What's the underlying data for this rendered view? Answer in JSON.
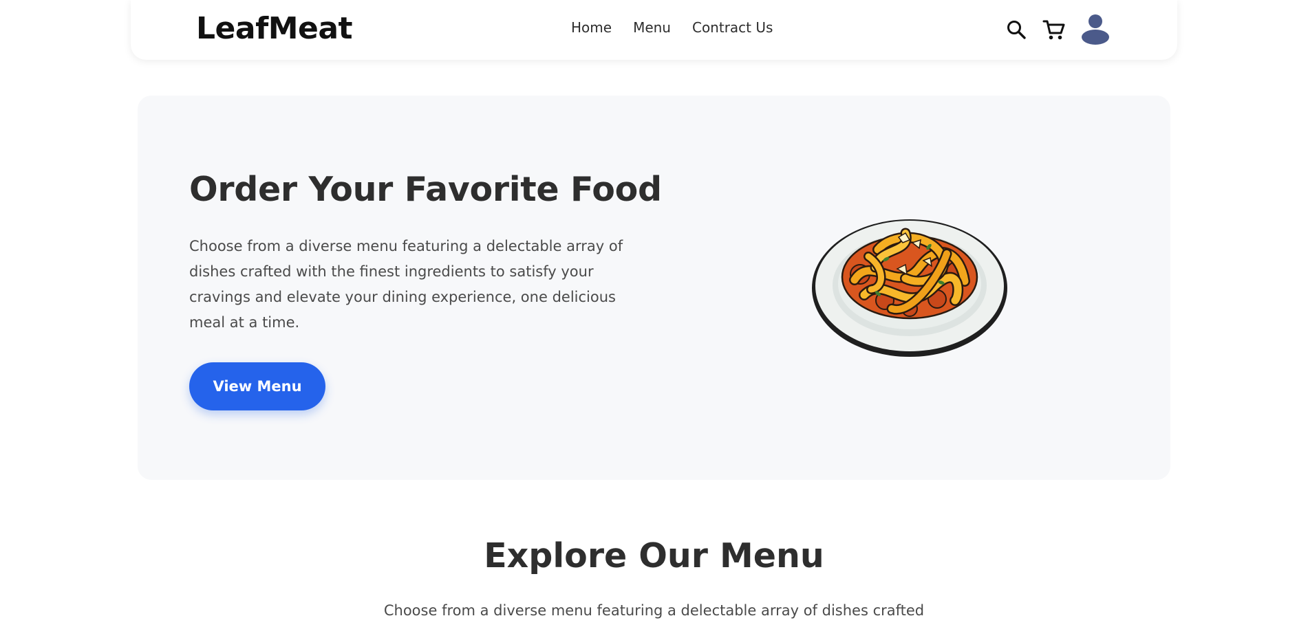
{
  "header": {
    "logo": "LeafMeat",
    "nav": [
      {
        "label": "Home"
      },
      {
        "label": "Menu"
      },
      {
        "label": "Contract Us"
      }
    ],
    "icons": [
      "search-icon",
      "cart-icon",
      "user-avatar-icon"
    ]
  },
  "hero": {
    "title": "Order Your Favorite Food",
    "description": "Choose from a diverse menu featuring a delectable array of dishes crafted with the finest ingredients to satisfy your cravings and elevate your dining experience, one delicious meal at a time.",
    "button_label": "View Menu",
    "image": "pasta-plate-illustration"
  },
  "explore": {
    "title": "Explore Our Menu",
    "description": "Choose from a diverse menu featuring a delectable array of dishes crafted"
  },
  "colors": {
    "accent": "#2563eb",
    "hero_bg": "#f7f8fa",
    "avatar": "#4b5a8a"
  }
}
